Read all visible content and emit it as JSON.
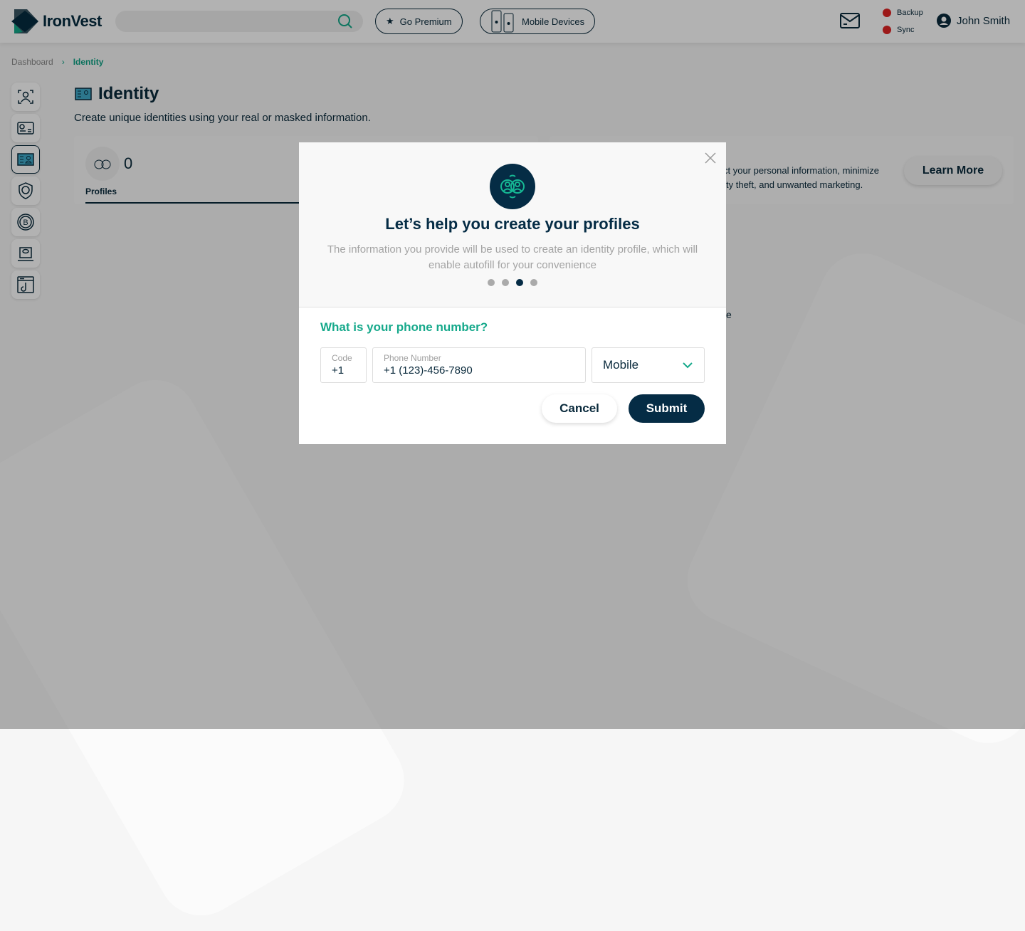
{
  "header": {
    "brand": "IronVest",
    "search_placeholder": "",
    "premium_label": "Go Premium",
    "mobile_label": "Mobile Devices",
    "backup_label": "Backup",
    "sync_label": "Sync",
    "user_name": "John Smith",
    "status_color": "#e02424"
  },
  "breadcrumb": {
    "items": [
      "Dashboard",
      "Identity"
    ]
  },
  "sidebar": {
    "items": [
      "face-id",
      "card",
      "identity",
      "shield-user",
      "bitcoin",
      "laptop-eye",
      "phishing"
    ],
    "active": "identity"
  },
  "page": {
    "title": "Identity",
    "subtitle": "Create unique identities using your real or masked information.",
    "profiles_count": "0",
    "profiles_label": "Profiles",
    "info_line1": "ct your personal information, minimize",
    "info_line2": "ty theft, and unwanted marketing.",
    "learn_more": "Learn More",
    "frag_behind": "e"
  },
  "modal": {
    "title": "Let’s help you create your profiles",
    "description": "The information you provide will be used to create an identity profile, which will enable autofill for your convenience",
    "step": 3,
    "steps": 4,
    "question": "What is your phone number?",
    "code_label": "Code",
    "code_value": "+1",
    "phone_label": "Phone Number",
    "phone_value": "+1 (123)-456-7890",
    "type_value": "Mobile",
    "cancel": "Cancel",
    "submit": "Submit"
  },
  "colors": {
    "primary": "#052c45",
    "accent": "#16a98b"
  }
}
